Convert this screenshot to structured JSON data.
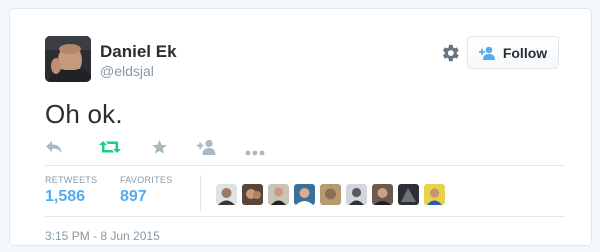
{
  "author": {
    "name": "Daniel Ek",
    "handle": "@eldsjal"
  },
  "follow_button": {
    "label": "Follow"
  },
  "tweet": {
    "text": "Oh ok."
  },
  "actions": [
    "reply-icon",
    "retweet-icon",
    "favorite-icon",
    "follow-icon",
    "more-icon"
  ],
  "stats": {
    "retweets_label": "RETWEETS",
    "retweets_count": "1,586",
    "favorites_label": "FAVORITES",
    "favorites_count": "897"
  },
  "timestamp": "3:15 PM - 8 Jun 2015",
  "colors": {
    "link": "#55acee",
    "retweet_active": "#19cf86",
    "muted": "#8899a6",
    "text": "#292f33",
    "border": "#e1e8ed"
  }
}
